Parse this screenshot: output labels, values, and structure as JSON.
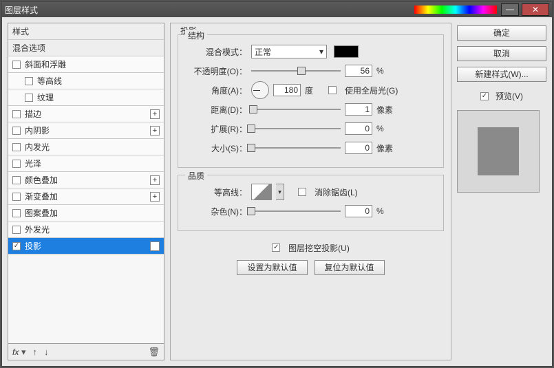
{
  "title": "图层样式",
  "left": {
    "header1": "样式",
    "header2": "混合选项",
    "items": [
      {
        "label": "斜面和浮雕",
        "checked": false,
        "sub": false,
        "plus": false
      },
      {
        "label": "等高线",
        "checked": false,
        "sub": true,
        "plus": false
      },
      {
        "label": "纹理",
        "checked": false,
        "sub": true,
        "plus": false
      },
      {
        "label": "描边",
        "checked": false,
        "sub": false,
        "plus": true
      },
      {
        "label": "内阴影",
        "checked": false,
        "sub": false,
        "plus": true
      },
      {
        "label": "内发光",
        "checked": false,
        "sub": false,
        "plus": false
      },
      {
        "label": "光泽",
        "checked": false,
        "sub": false,
        "plus": false
      },
      {
        "label": "颜色叠加",
        "checked": false,
        "sub": false,
        "plus": true
      },
      {
        "label": "渐变叠加",
        "checked": false,
        "sub": false,
        "plus": true
      },
      {
        "label": "图案叠加",
        "checked": false,
        "sub": false,
        "plus": false
      },
      {
        "label": "外发光",
        "checked": false,
        "sub": false,
        "plus": false
      },
      {
        "label": "投影",
        "checked": true,
        "sub": false,
        "plus": true,
        "selected": true
      }
    ],
    "fx_label": "fx"
  },
  "main": {
    "title": "投影",
    "structure_title": "结构",
    "blend_mode_label": "混合模式：",
    "blend_mode_value": "正常",
    "opacity_label": "不透明度(O)：",
    "opacity_value": "56",
    "opacity_unit": "%",
    "angle_label": "角度(A)：",
    "angle_value": "180",
    "angle_unit": "度",
    "global_light_label": "使用全局光(G)",
    "distance_label": "距离(D)：",
    "distance_value": "1",
    "distance_unit": "像素",
    "spread_label": "扩展(R)：",
    "spread_value": "0",
    "spread_unit": "%",
    "size_label": "大小(S)：",
    "size_value": "0",
    "size_unit": "像素",
    "quality_title": "品质",
    "contour_label": "等高线：",
    "antialias_label": "消除锯齿(L)",
    "noise_label": "杂色(N)：",
    "noise_value": "0",
    "noise_unit": "%",
    "knockout_label": "图层挖空投影(U)",
    "set_default": "设置为默认值",
    "reset_default": "复位为默认值"
  },
  "right": {
    "ok": "确定",
    "cancel": "取消",
    "new_style": "新建样式(W)...",
    "preview": "预览(V)"
  }
}
